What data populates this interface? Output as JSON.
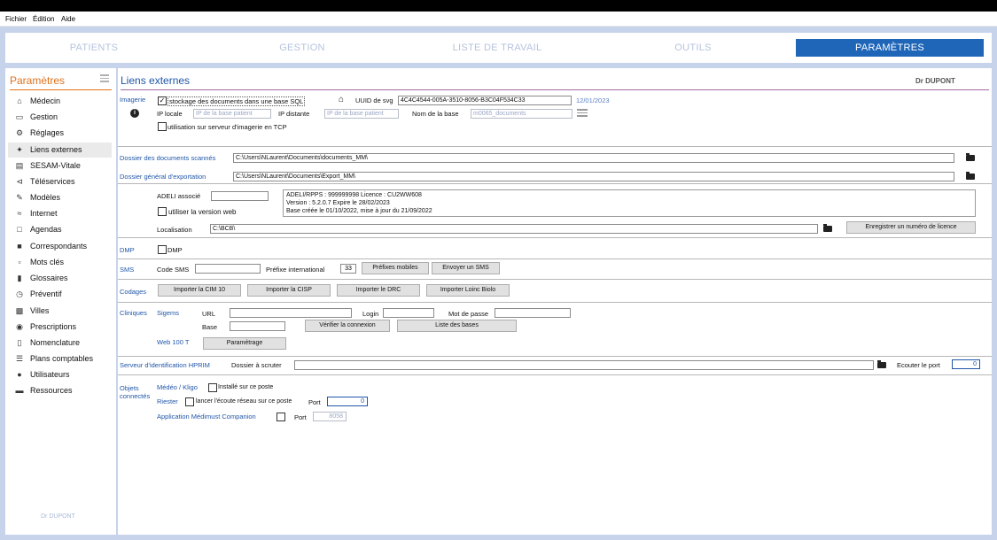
{
  "menu": {
    "items": [
      "Fichier",
      "Édition",
      "Aide"
    ]
  },
  "tabs": [
    {
      "label": "PATIENTS",
      "active": false
    },
    {
      "label": "GESTION",
      "active": false
    },
    {
      "label": "LISTE DE TRAVAIL",
      "active": false
    },
    {
      "label": "OUTILS",
      "active": false
    },
    {
      "label": "PARAMÈTRES",
      "active": true
    }
  ],
  "sidebar": {
    "title": "Paramètres",
    "items": [
      {
        "label": "Médecin",
        "icon": "home-icon"
      },
      {
        "label": "Gestion",
        "icon": "drive-icon"
      },
      {
        "label": "Réglages",
        "icon": "cogs-icon"
      },
      {
        "label": "Liens externes",
        "icon": "network-icon",
        "selected": true
      },
      {
        "label": "SESAM-Vitale",
        "icon": "card-icon"
      },
      {
        "label": "Téléservices",
        "icon": "share-icon"
      },
      {
        "label": "Modèles",
        "icon": "edit-icon"
      },
      {
        "label": "Internet",
        "icon": "wifi-icon"
      },
      {
        "label": "Agendas",
        "icon": "calendar-icon"
      },
      {
        "label": "Correspondants",
        "icon": "contact-icon"
      },
      {
        "label": "Mots clés",
        "icon": "chart-icon"
      },
      {
        "label": "Glossaires",
        "icon": "book-icon"
      },
      {
        "label": "Préventif",
        "icon": "clock-icon"
      },
      {
        "label": "Villes",
        "icon": "city-icon"
      },
      {
        "label": "Prescriptions",
        "icon": "pills-icon"
      },
      {
        "label": "Nomenclature",
        "icon": "document-icon"
      },
      {
        "label": "Plans comptables",
        "icon": "list-icon"
      },
      {
        "label": "Utilisateurs",
        "icon": "users-icon"
      },
      {
        "label": "Ressources",
        "icon": "car-icon"
      }
    ],
    "footer": "Dr DUPONT"
  },
  "main": {
    "title": "Liens externes",
    "doctor": "Dr DUPONT",
    "imagerie": {
      "section": "Imagerie",
      "store_label": "stockage des documents dans une base SQL",
      "uuid_label": "UUID de svg",
      "uuid_value": "4C4C4544-005A-3510-8056-B3C04F534C33",
      "date": "12/01/2023",
      "ip_locale_label": "IP locale",
      "ip_locale_placeholder": "IP de la base patient",
      "ip_distante_label": "IP distante",
      "ip_distante_placeholder": "IP de la base patient",
      "base_label": "Nom de la base",
      "base_value": "m0065_documents",
      "tcp_label": "utilisation sur serveur d'imagerie en TCP"
    },
    "dossier_scannes": {
      "label": "Dossier des documents scannés",
      "value": "C:\\Users\\NLaurent\\Documents\\documents_MM\\"
    },
    "dossier_export": {
      "label": "Dossier général d'exportation",
      "value": "C:\\Users\\NLaurent\\Documents\\Export_MM\\"
    },
    "bcb": {
      "adeli_label": "ADELI associé",
      "adeli_value": "",
      "web_label": "utiliser la version web",
      "info1": "ADELI/RPPS : 999999998 Licence : CU2WW608",
      "info2": "Version : 5.2.0.7   Expire le 28/02/2023",
      "info3": "Base créée le 01/10/2022, mise à jour du 21/09/2022",
      "loc_label": "Localisation",
      "loc_value": "C:\\BCB\\",
      "licence_btn": "Enregistrer un numéro de licence"
    },
    "dmp": {
      "section": "DMP",
      "label": "DMP"
    },
    "sms": {
      "section": "SMS",
      "code_label": "Code SMS",
      "code_value": "",
      "prefix_label": "Préfixe international",
      "prefix_value": "33",
      "btn_prefixes": "Préfixes mobiles",
      "btn_send": "Envoyer un SMS"
    },
    "codages": {
      "section": "Codages",
      "btn1": "Importer la CIM 10",
      "btn2": "Importer la CISP",
      "btn3": "Importer le DRC",
      "btn4": "Importer Loinc Biolo"
    },
    "cliniques": {
      "section": "Cliniques",
      "sigems": "Sigems",
      "url_label": "URL",
      "login_label": "Login",
      "password_label": "Mot de passe",
      "base_label": "Base",
      "btn_verify": "Vérifier la connexion",
      "btn_list": "Liste des bases",
      "web100t": "Web 100 T",
      "btn_param": "Paramétrage"
    },
    "hprim": {
      "section": "Serveur d'identification HPRIM",
      "folder_label": "Dossier à scruter",
      "folder_value": "",
      "port_label": "Ecouter le port",
      "port_value": "0"
    },
    "objets": {
      "section_line1": "Objets",
      "section_line2": "connectés",
      "medeo": "Médéo / Kligo",
      "medeo_check": "Installé sur ce poste",
      "riester": "Riester",
      "riester_check": "lancer l'écoute réseau sur ce poste",
      "port_label": "Port",
      "riester_port": "0",
      "companion": "Application Médimust Companion",
      "companion_port": "8058"
    }
  }
}
